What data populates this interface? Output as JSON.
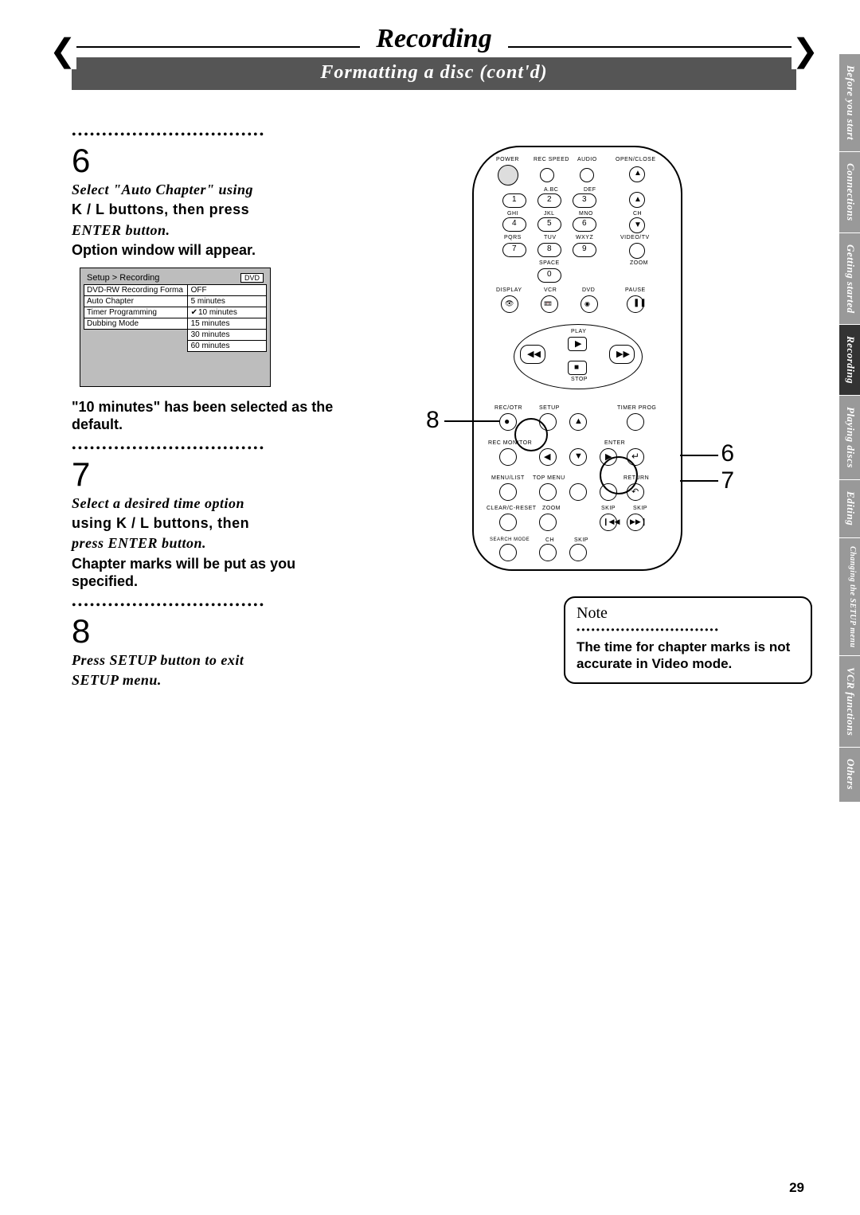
{
  "header": {
    "title": "Recording",
    "subtitle": "Formatting a disc (cont'd)"
  },
  "steps": {
    "s6": {
      "num": "6",
      "instr_a": "Select \"Auto Chapter\" using",
      "instr_b": "K / L buttons, then press",
      "instr_c": "ENTER button.",
      "sub": "Option window will appear.",
      "note": "\"10 minutes\" has been selected as the default."
    },
    "s7": {
      "num": "7",
      "instr_a": "Select a desired time option",
      "instr_b": "using K / L buttons, then",
      "instr_c": "press ENTER button.",
      "sub": "Chapter marks will be put as you specified."
    },
    "s8": {
      "num": "8",
      "instr_a": "Press SETUP button to exit",
      "instr_b": "SETUP menu."
    }
  },
  "osd": {
    "breadcrumb": "Setup > Recording",
    "badge": "DVD",
    "left": [
      "DVD-RW Recording Forma",
      "Auto Chapter",
      "Timer Programming",
      "Dubbing Mode"
    ],
    "right": [
      "OFF",
      "5 minutes",
      "10 minutes",
      "15 minutes",
      "30 minutes",
      "60 minutes"
    ]
  },
  "remote_labels": {
    "r1": [
      "POWER",
      "REC SPEED",
      "AUDIO",
      "OPEN/CLOSE"
    ],
    "r2": [
      "",
      "A.BC",
      "DEF",
      ""
    ],
    "n1": [
      "1",
      "2",
      "3"
    ],
    "r3": [
      "GHI",
      "JKL",
      "MNO"
    ],
    "n2": [
      "4",
      "5",
      "6"
    ],
    "r4": [
      "PQRS",
      "TUV",
      "WXYZ",
      "VIDEO/TV"
    ],
    "n3": [
      "7",
      "8",
      "9"
    ],
    "r5": [
      "",
      "SPACE",
      "",
      "ZOOM"
    ],
    "n4": [
      "0"
    ],
    "r6": [
      "DISPLAY",
      "VCR",
      "DVD",
      "PAUSE"
    ],
    "mid": [
      "PLAY",
      "STOP"
    ],
    "r7": [
      "REC/OTR",
      "SETUP",
      "",
      "TIMER PROG"
    ],
    "r8": [
      "REC MONITOR",
      "",
      "ENTER",
      ""
    ],
    "r9": [
      "MENU/LIST",
      "TOP MENU",
      "",
      "RETURN"
    ],
    "r10": [
      "CLEAR/C-RESET",
      "ZOOM",
      "SKIP",
      "SKIP"
    ],
    "r11": [
      "SEARCH MODE",
      "CH",
      "SKIP",
      ""
    ]
  },
  "callouts": {
    "c8": "8",
    "c6": "6",
    "c7": "7"
  },
  "note": {
    "title": "Note",
    "text": "The time for chapter marks is not accurate in Video mode."
  },
  "tabs": [
    "Before you start",
    "Connections",
    "Getting started",
    "Recording",
    "Playing discs",
    "Editing",
    "Changing the SETUP menu",
    "VCR functions",
    "Others"
  ],
  "page_number": "29"
}
